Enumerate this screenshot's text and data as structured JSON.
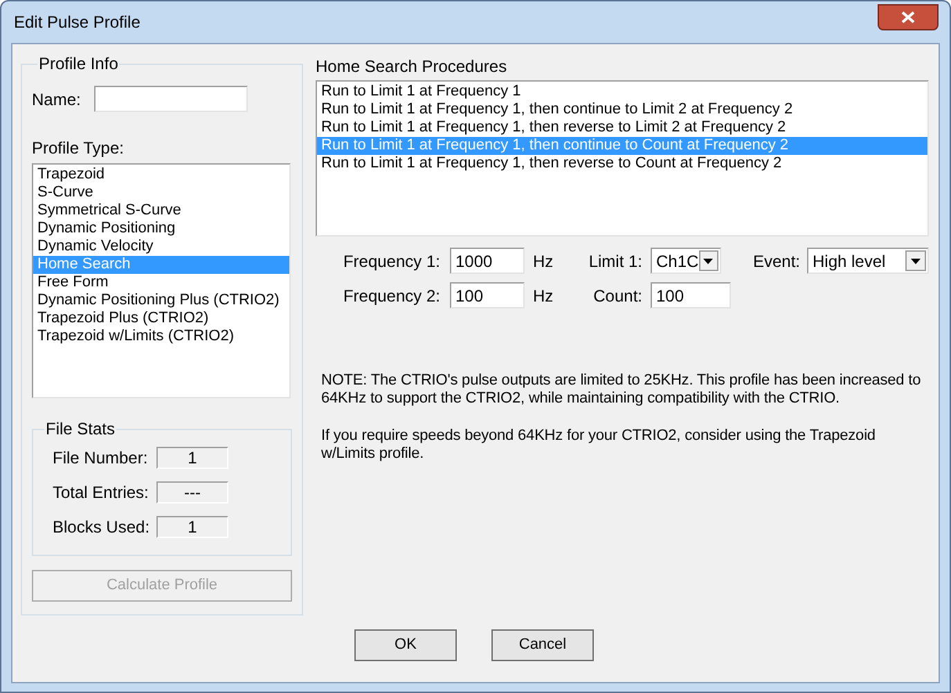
{
  "window": {
    "title": "Edit Pulse Profile"
  },
  "profile_info": {
    "title": "Profile Info",
    "name_label": "Name:",
    "type_label": "Profile Type:",
    "types": [
      {
        "label": "Trapezoid",
        "selected": false
      },
      {
        "label": "S-Curve",
        "selected": false
      },
      {
        "label": "Symmetrical S-Curve",
        "selected": false
      },
      {
        "label": "Dynamic Positioning",
        "selected": false
      },
      {
        "label": "Dynamic Velocity",
        "selected": false
      },
      {
        "label": "Home Search",
        "selected": true
      },
      {
        "label": "Free Form",
        "selected": false
      },
      {
        "label": "Dynamic Positioning Plus (CTRIO2)",
        "selected": false
      },
      {
        "label": "Trapezoid Plus (CTRIO2)",
        "selected": false
      },
      {
        "label": "Trapezoid w/Limits (CTRIO2)",
        "selected": false
      }
    ]
  },
  "file_stats": {
    "title": "File Stats",
    "rows": [
      {
        "label": "File Number:",
        "value": "1"
      },
      {
        "label": "Total Entries:",
        "value": "---"
      },
      {
        "label": "Blocks Used:",
        "value": "1"
      }
    ]
  },
  "calculate_button": {
    "label": "Calculate Profile",
    "disabled": true
  },
  "home_search": {
    "label": "Home Search Procedures",
    "items": [
      {
        "label": "Run to Limit 1 at Frequency 1",
        "selected": false
      },
      {
        "label": "Run to Limit 1 at Frequency 1, then continue to Limit 2 at Frequency 2",
        "selected": false
      },
      {
        "label": "Run to Limit 1 at Frequency 1, then reverse to Limit 2 at Frequency 2",
        "selected": false
      },
      {
        "label": "Run to Limit 1 at Frequency 1, then continue to Count at Frequency 2",
        "selected": true
      },
      {
        "label": "Run to Limit 1 at Frequency 1, then reverse to Count at Frequency 2",
        "selected": false
      }
    ]
  },
  "frequency_1": {
    "label": "Frequency 1:",
    "value": "1000",
    "unit": "Hz"
  },
  "frequency_2": {
    "label": "Frequency 2:",
    "value": "100",
    "unit": "Hz"
  },
  "limit_1": {
    "label": "Limit 1:",
    "value": "Ch1C"
  },
  "event": {
    "label": "Event:",
    "value": "High level"
  },
  "count": {
    "label": "Count:",
    "value": "100"
  },
  "notes": [
    "NOTE: The CTRIO's pulse outputs are limited to 25KHz. This profile has been increased to 64KHz to support the CTRIO2, while maintaining compatibility with the CTRIO.",
    "If you require speeds beyond 64KHz for your CTRIO2, consider using the Trapezoid w/Limits profile."
  ],
  "buttons": [
    "OK",
    "Cancel"
  ]
}
